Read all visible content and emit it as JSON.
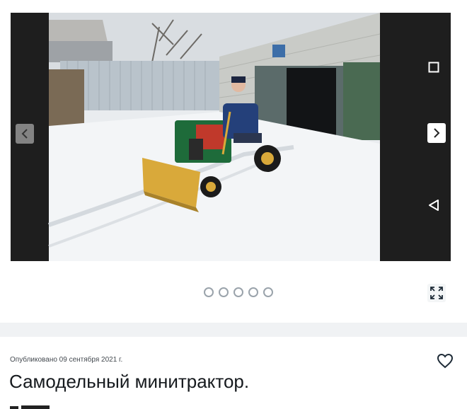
{
  "gallery": {
    "image_alt": "Самодельный минитрактор с отвалом в снегу",
    "slides_count": 5,
    "active_slide": 1,
    "prev_icon": "chevron-left-icon",
    "next_icon": "chevron-right-icon",
    "expand_icon": "expand-icon"
  },
  "android_nav": {
    "recents_icon": "square-icon",
    "back_icon": "triangle-back-icon"
  },
  "article": {
    "published": "Опубликовано 09 сентября 2021 г.",
    "title": "Самодельный минитрактор.",
    "like_icon": "heart-icon"
  },
  "colors": {
    "tractor_green": "#1e6b3a",
    "blade_yellow": "#d9a93a",
    "separator": "#f0f2f4",
    "dot_border": "#9aa3ab"
  }
}
